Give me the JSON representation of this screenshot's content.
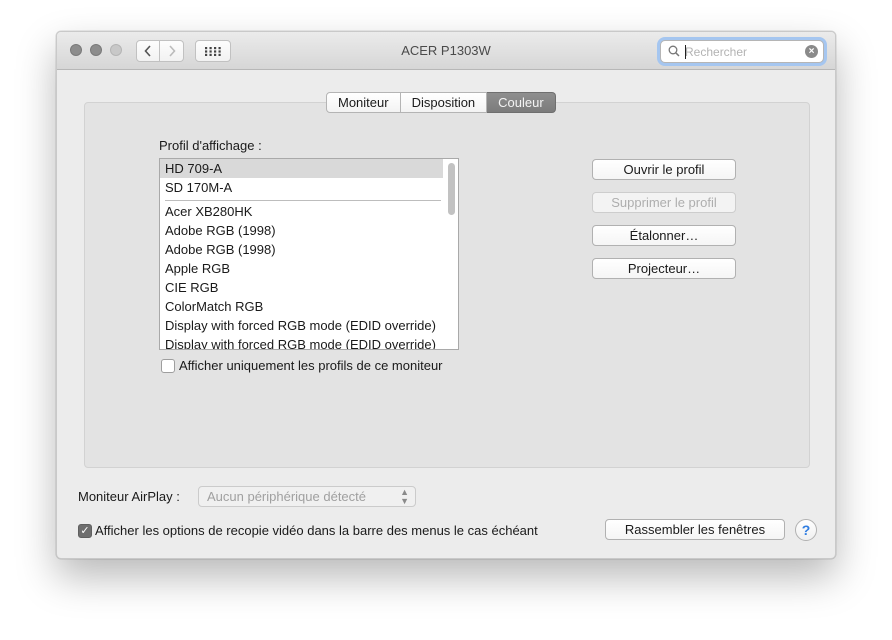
{
  "window": {
    "title": "ACER P1303W",
    "search_placeholder": "Rechercher",
    "nav_back_icon": "chevron-left-icon",
    "nav_forward_icon": "chevron-right-icon",
    "show_all_icon": "grid-icon"
  },
  "tabs": [
    {
      "label": "Moniteur",
      "selected": false
    },
    {
      "label": "Disposition",
      "selected": false
    },
    {
      "label": "Couleur",
      "selected": true
    }
  ],
  "color": {
    "profile_label": "Profil d'affichage :",
    "profiles": [
      "HD 709-A",
      "SD 170M-A",
      "Acer XB280HK",
      "Adobe RGB (1998)",
      "Adobe RGB (1998)",
      "Apple RGB",
      "CIE RGB",
      "ColorMatch RGB",
      "Display with forced RGB mode (EDID override)",
      "Display with forced RGB mode (EDID override)"
    ],
    "selected_profile": "HD 709-A",
    "only_this_monitor_label": "Afficher uniquement les profils de ce moniteur",
    "only_this_monitor_checked": false,
    "buttons": {
      "open_profile": "Ouvrir le profil",
      "delete_profile": "Supprimer le profil",
      "calibrate": "Étalonner…",
      "projector": "Projecteur…"
    }
  },
  "footer": {
    "airplay_label": "Moniteur AirPlay :",
    "airplay_value": "Aucun périphérique détecté",
    "mirroring_label": "Afficher les options de recopie vidéo dans la barre des menus le cas échéant",
    "mirroring_checked": true,
    "gather_windows": "Rassembler les fenêtres",
    "help": "?"
  },
  "colors": {
    "selected_tab": "#7c7c7c",
    "focus_ring": "#a5c6f0",
    "help_blue": "#2f7de1"
  }
}
